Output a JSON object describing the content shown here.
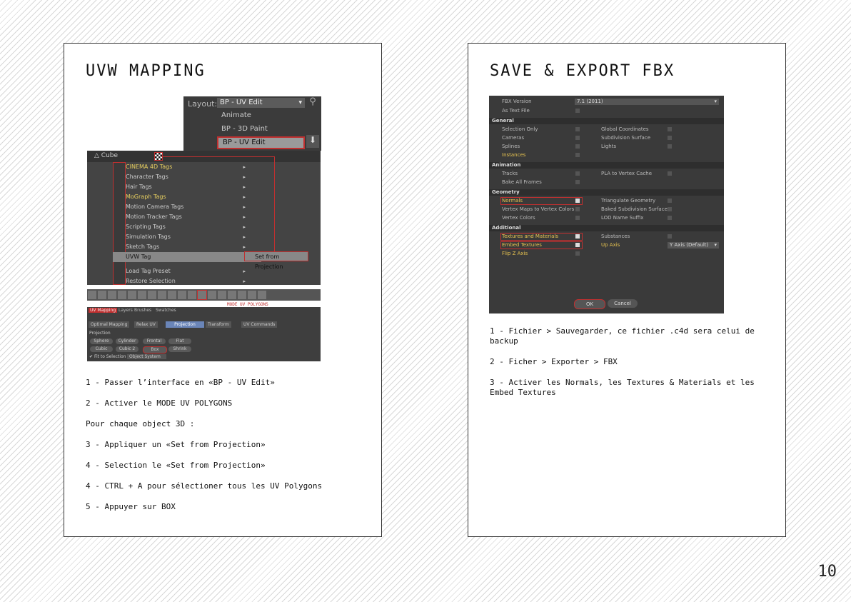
{
  "page_number": "10",
  "left_card": {
    "title": "UVW MAPPING",
    "layout_widget": {
      "label": "Layout:",
      "selected": "BP - UV Edit",
      "options": [
        "Animate",
        "BP - 3D Paint",
        "BP - UV Edit"
      ]
    },
    "object_name": "Cube",
    "tag_menu_items": [
      "CINEMA 4D Tags",
      "Character Tags",
      "Hair Tags",
      "MoGraph Tags",
      "Motion Camera Tags",
      "Motion Tracker Tags",
      "Scripting Tags",
      "Simulation Tags",
      "Sketch Tags",
      "UVW Tag",
      "Load Tag Preset",
      "Restore Selection"
    ],
    "submenu_item": "Set from Projection",
    "mode_label": "MODE UV POLYGONS",
    "uv_tabs": [
      "UV Mapping",
      "Layers",
      "Brushes",
      "Swatches"
    ],
    "uv_subtabs": [
      "Optimal Mapping",
      "Relax UV",
      "Projection",
      "Transform",
      "UV Commands"
    ],
    "projection_label": "Projection",
    "projection_buttons_row1": [
      "Sphere",
      "Cylinder",
      "Frontal",
      "Flat"
    ],
    "projection_buttons_row2": [
      "Cubic",
      "Cubic 2",
      "Box",
      "Shrink"
    ],
    "fit_label": "Fit to Selection",
    "fit_value": "Object System",
    "steps": [
      "1 - Passer l’interface en «BP - UV Edit»",
      "2 - Activer le MODE UV POLYGONS",
      "Pour chaque object 3D :",
      "3 - Appliquer un «Set from Projection»",
      "4 - Selection le «Set from Projection»",
      "4 - CTRL + A pour sélectioner tous les UV Polygons",
      "5 - Appuyer sur BOX"
    ]
  },
  "right_card": {
    "title": "SAVE & EXPORT FBX",
    "fbx_dialog": {
      "fbx_version_label": "FBX Version",
      "fbx_version_value": "7.1 (2011)",
      "as_text_file": "As Text File",
      "sections": [
        "General",
        "Animation",
        "Geometry",
        "Additional"
      ],
      "general_left": [
        "Selection Only",
        "Cameras",
        "Splines",
        "Instances"
      ],
      "general_right": [
        "Global Coordinates",
        "Subdivision Surface",
        "Lights"
      ],
      "animation_left": [
        "Tracks",
        "Bake All Frames"
      ],
      "animation_right": [
        "PLA to Vertex Cache"
      ],
      "geometry_left": [
        "Normals",
        "Vertex Maps to Vertex Colors",
        "Vertex Colors"
      ],
      "geometry_right": [
        "Triangulate Geometry",
        "Baked Subdivision Surface",
        "LOD Name Suffix"
      ],
      "additional_left": [
        "Textures and Materials",
        "Embed Textures",
        "Flip Z Axis"
      ],
      "additional_right": [
        "Substances",
        "Up Axis"
      ],
      "up_axis_value": "Y Axis (Default)",
      "ok": "OK",
      "cancel": "Cancel"
    },
    "steps": [
      "1 - Fichier > Sauvegarder, ce fichier .c4d sera celui de backup",
      "2 - Ficher > Exporter > FBX",
      "3 - Activer les Normals, les Textures & Materials et les Embed Textures"
    ]
  }
}
